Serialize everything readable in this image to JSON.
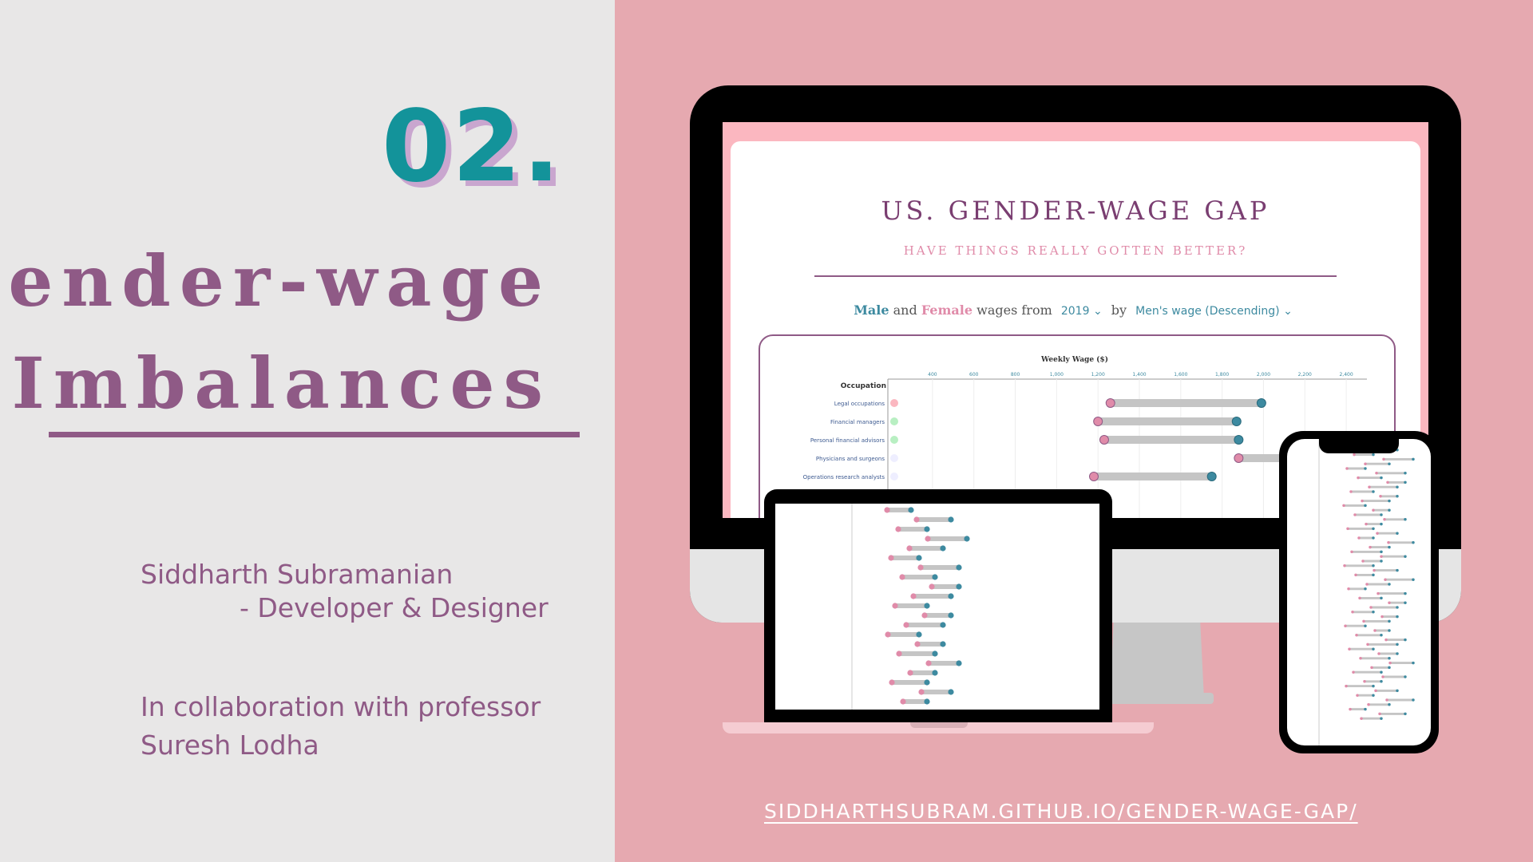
{
  "slide": {
    "number": "02.",
    "title_line1": "Gender-wage",
    "title_line2": "Imbalances",
    "author_name": "Siddharth Subramanian",
    "author_role": "- Developer & Designer",
    "collab_line1": "In collaboration with professor",
    "collab_line2": "Suresh Lodha",
    "url": "SIDDHARTHSUBRAM.GITHUB.IO/GENDER-WAGE-GAP/"
  },
  "colors": {
    "left_bg": "#e8e7e7",
    "right_bg": "#e6a9b0",
    "accent_teal": "#13939a",
    "accent_purple": "#8f5a86",
    "male": "#3d8aa0",
    "female": "#e08ba9"
  },
  "website": {
    "title": "US. GENDER-WAGE GAP",
    "subtitle": "HAVE THINGS REALLY GOTTEN BETTER?",
    "controls": {
      "male": "Male",
      "and": "and",
      "female": "Female",
      "wages_from": "wages from",
      "year": "2019",
      "by": "by",
      "sort": "Men's wage (Descending)"
    }
  },
  "chart_data": {
    "type": "dumbbell",
    "title": "Weekly Wage ($)",
    "ylabel": "Occupation",
    "x_ticks": [
      "400",
      "600",
      "800",
      "1,000",
      "1,200",
      "1,400",
      "1,600",
      "1,800",
      "2,000",
      "2,200",
      "2,400"
    ],
    "xlim": [
      300,
      2500
    ],
    "categories": [
      "Legal occupations",
      "Financial managers",
      "Personal financial advisors",
      "Physicians and surgeons",
      "Operations research analysts"
    ],
    "series": [
      {
        "name": "Female",
        "values": [
          1260,
          1200,
          1230,
          1880,
          1180
        ]
      },
      {
        "name": "Male",
        "values": [
          1990,
          1870,
          1880,
          2150,
          1750
        ]
      }
    ]
  }
}
